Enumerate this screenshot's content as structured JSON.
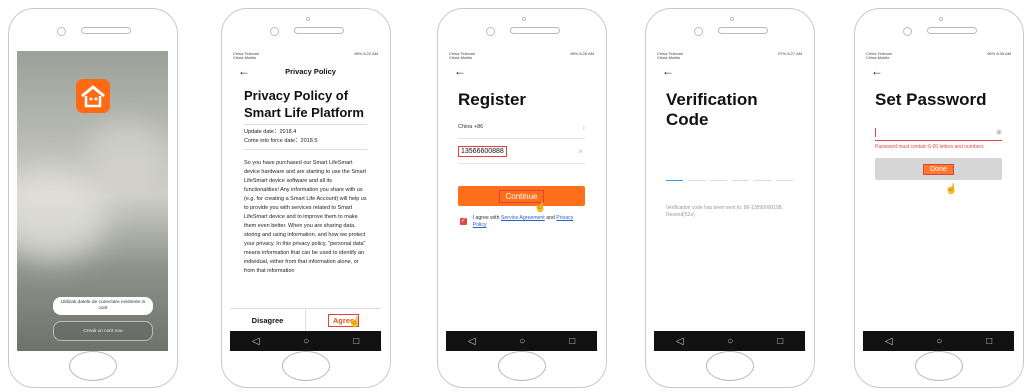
{
  "status_bar": {
    "carrier_line1": "China Telecom",
    "carrier_line2": "China Mobile",
    "screen2_time": "98% 8:22 AM",
    "screen3_time": "98% 8:26 AM",
    "screen4_time": "97% 8:27 AM",
    "screen5_time": "96% 8:35 AM"
  },
  "screen1": {
    "login_button": "Utilizati datele de conectare existente in cont",
    "create_button": "Creati un cont nou"
  },
  "screen2": {
    "back": "←",
    "header_title": "Privacy Policy",
    "title": "Privacy Policy of Smart Life Platform",
    "update_date": "Update date：2018.4",
    "force_date": "Come into force date：2018.5",
    "body": "So you have purchased our Smart LifeSmart device hardware and are starting to use the Smart LifeSmart device software and all its functionalities! Any information you share with us (e.g. for creating a Smart Life Account) will help us to provide you with services related to Smart LifeSmart device and to improve them to make them even better. When you are sharing data, storing and using information, and how we protect your privacy. In this privacy policy, \"personal data\" means information that can be used to identify an individual, either from that information alone, or from that information",
    "disagree": "Disagree",
    "agree": "Agree"
  },
  "screen3": {
    "back": "←",
    "title": "Register",
    "country": "China +86",
    "chevron": "›",
    "phone": "13566600888",
    "clear": "×",
    "continue": "Continue",
    "agree_prefix": "I agree with ",
    "service_agreement": "Service Agreement",
    "and": " and ",
    "privacy_policy": "Privacy Policy"
  },
  "screen4": {
    "back": "←",
    "title": "Verification Code",
    "info": "Verification code has been sent to: 86-13599900198, Resend(52s)"
  },
  "screen5": {
    "back": "←",
    "title": "Set Password",
    "eye": "◉",
    "error": "Password must contain 6-20 letters and numbers",
    "done": "Done"
  },
  "nav": {
    "back": "◁",
    "home": "○",
    "recent": "□"
  },
  "colors": {
    "accent": "#ff6f1a",
    "highlight_box": "#e04040",
    "link": "#2b62c9"
  }
}
